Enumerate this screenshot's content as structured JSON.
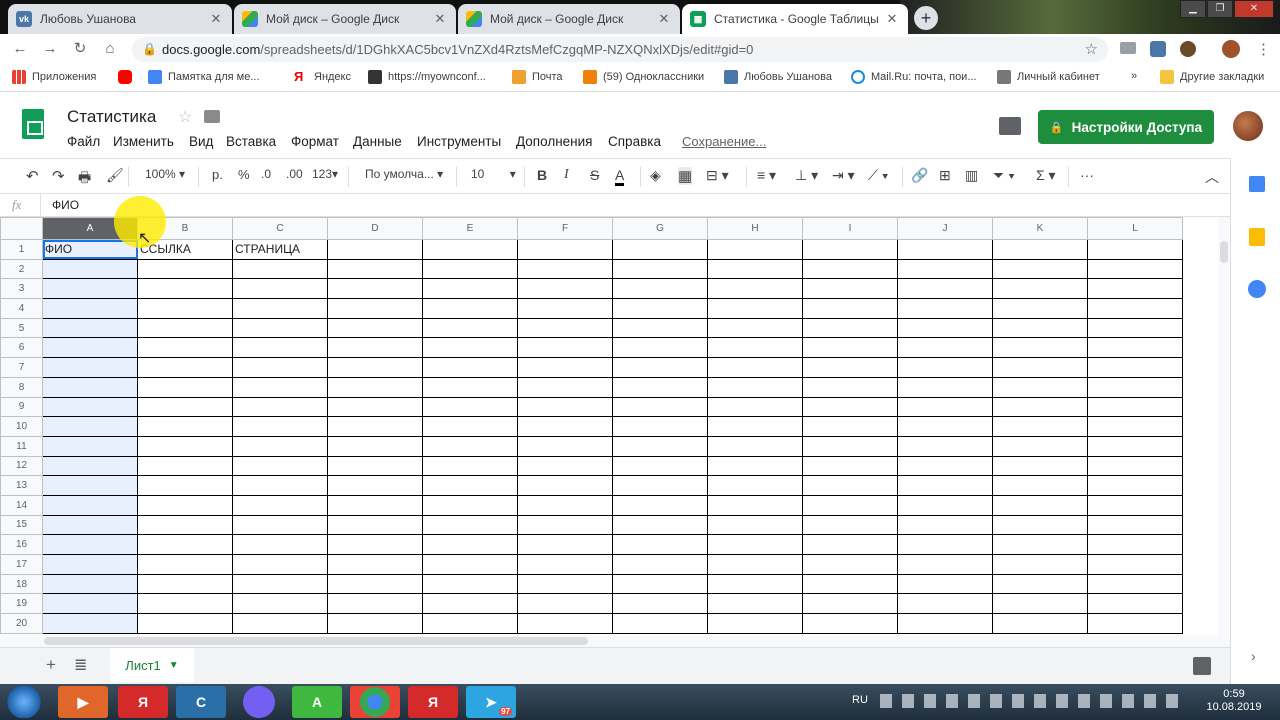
{
  "browser": {
    "tabs": [
      {
        "title": "Любовь Ушанова",
        "icon": "vk-icon",
        "active": false
      },
      {
        "title": "Мой диск – Google Диск",
        "icon": "google-drive-icon",
        "active": false
      },
      {
        "title": "Мой диск – Google Диск",
        "icon": "google-drive-icon",
        "active": false
      },
      {
        "title": "Статистика - Google Таблицы",
        "icon": "google-sheets-icon",
        "active": true
      }
    ],
    "url_host": "docs.google.com",
    "url_path": "/spreadsheets/d/1DGhkXAC5bcv1VnZXd4RztsMefCzgqMP-NZXQNxlXDjs/edit#gid=0",
    "bookmarks": [
      "Приложения",
      "",
      "Памятка для ме...",
      "Яндекс",
      "https://myownconf...",
      "Почта",
      "(59) Одноклассники",
      "Любовь Ушанова",
      "Mail.Ru: почта, пои...",
      "Личный кабинет"
    ],
    "other_bookmarks": "Другие закладки",
    "more_bookmarks": "»"
  },
  "sheets": {
    "title": "Статистика",
    "menu": [
      "Файл",
      "Изменить",
      "Вид",
      "Вставка",
      "Формат",
      "Данные",
      "Инструменты",
      "Дополнения",
      "Справка"
    ],
    "saving_status": "Сохранение...",
    "share_label": "Настройки Доступа",
    "toolbar": {
      "zoom": "100%",
      "currency": "р.",
      "percent": "%",
      "dec_less": ".0",
      "dec_more": ".00",
      "format_more": "123",
      "font": "По умолча...",
      "font_size": "10",
      "bold": "B",
      "italic": "I",
      "strike": "S",
      "text_color": "A",
      "more": "···"
    },
    "fx_label": "fx",
    "formula_value": "ФИО",
    "columns": [
      "A",
      "B",
      "C",
      "D",
      "E",
      "F",
      "G",
      "H",
      "I",
      "J",
      "K",
      "L"
    ],
    "rows": [
      "1",
      "2",
      "3",
      "4",
      "5",
      "6",
      "7",
      "8",
      "9",
      "10",
      "11",
      "12",
      "13",
      "14",
      "15",
      "16",
      "17",
      "18",
      "19",
      "20"
    ],
    "cells": {
      "A1": "ФИО",
      "B1": "ССЫЛКА",
      "C1": "СТРАНИЦА"
    },
    "selected_column": "A",
    "sheet_tab": "Лист1"
  },
  "taskbar": {
    "lang": "RU",
    "time": "0:59",
    "date": "10.08.2019",
    "telegram_badge": "97"
  },
  "colors": {
    "sheets_green": "#0f9d58",
    "share_green": "#1e8e3e",
    "selection_blue": "#1a73e8"
  }
}
